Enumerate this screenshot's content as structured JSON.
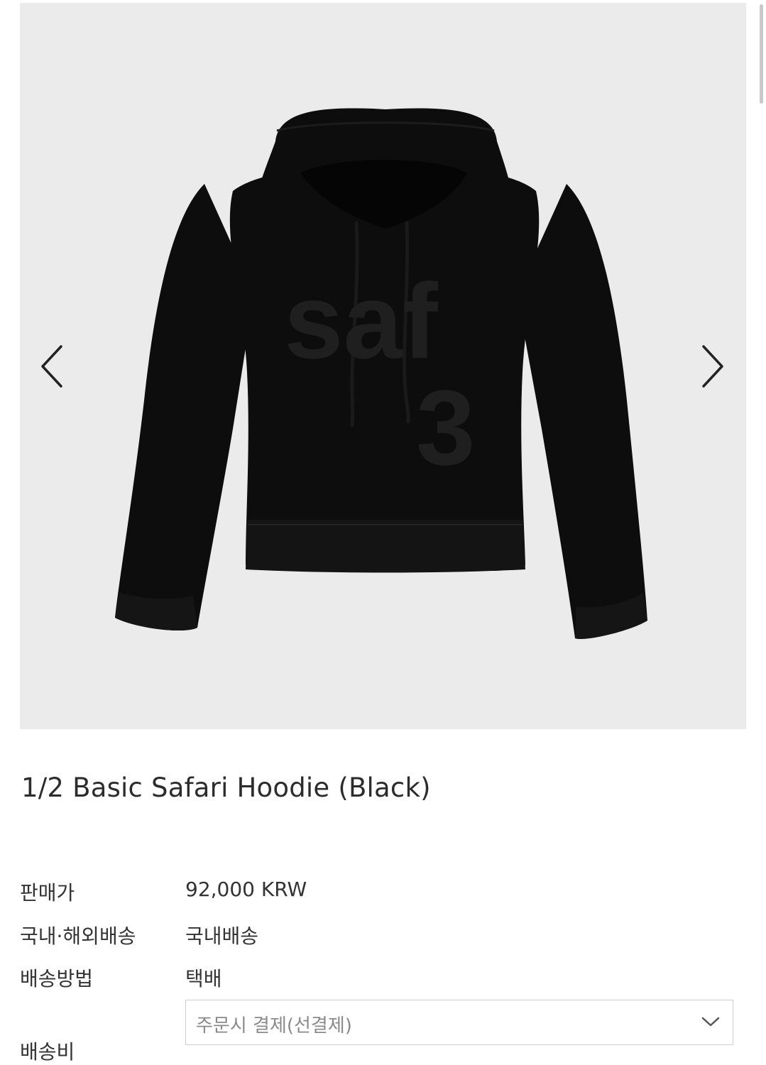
{
  "product": {
    "title": "1/2 Basic Safari Hoodie (Black)",
    "print_text_line1": "saf",
    "print_text_line2": "3"
  },
  "gallery": {
    "prev_icon": "chevron-left-icon",
    "next_icon": "chevron-right-icon"
  },
  "info": {
    "price_label": "판매가",
    "price_value": "92,000 KRW",
    "shipping_scope_label": "국내·해외배송",
    "shipping_scope_value": "국내배송",
    "shipping_method_label": "배송방법",
    "shipping_method_value": "택배",
    "shipping_fee_label": "배송비",
    "shipping_fee_selected": "주문시 결제(선결제)"
  },
  "colors": {
    "gallery_bg": "#ebebeb",
    "hoodie": "#0d0d0d",
    "print": "#1f1f1f",
    "text": "#333333"
  }
}
